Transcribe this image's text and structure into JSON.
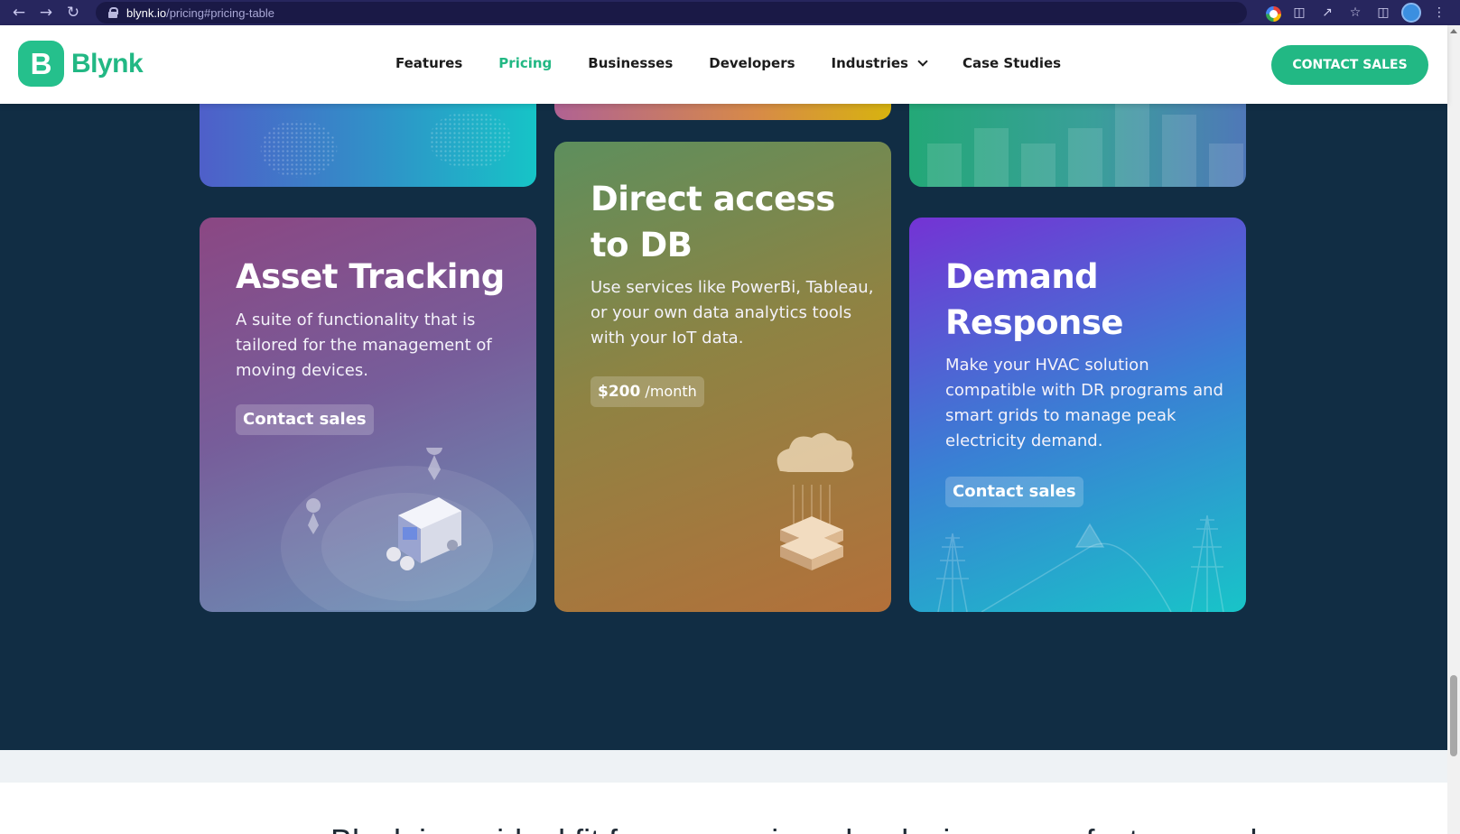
{
  "browser": {
    "url_host": "blynk.io",
    "url_path": "/pricing#pricing-table",
    "icons": [
      "back-icon",
      "forward-icon",
      "reload-icon",
      "lock-icon",
      "google-icon",
      "translate-icon",
      "share-icon",
      "star-icon",
      "sidebar-icon",
      "profile-avatar",
      "menu-icon"
    ]
  },
  "site": {
    "logo_letter": "B",
    "logo_text": "Blynk",
    "nav": [
      {
        "label": "Features"
      },
      {
        "label": "Pricing"
      },
      {
        "label": "Businesses"
      },
      {
        "label": "Developers"
      },
      {
        "label": "Industries"
      },
      {
        "label": "Case Studies"
      }
    ],
    "contact_button": "CONTACT SALES",
    "accent_color": "#22b884",
    "dark_bg": "#112d44"
  },
  "cards": {
    "asset": {
      "title_line1": "Asset Tracking",
      "desc_line1": "A suite of functionality that is",
      "desc_line2": "tailored for the management of",
      "desc_line3": "moving devices.",
      "button": "Contact sales"
    },
    "db": {
      "title_line1": "Direct access",
      "title_line2": "to DB",
      "desc_line1": "Use services like PowerBi, Tableau,",
      "desc_line2": "or your own data analytics tools",
      "desc_line3": "with your IoT data.",
      "price_amount": "$200",
      "price_period": "/month"
    },
    "demand": {
      "title_line1": "Demand",
      "title_line2": "Response",
      "desc_line1": "Make your HVAC solution",
      "desc_line2": "compatible with DR programs and",
      "desc_line3": "smart grids to manage peak",
      "desc_line4": "electricity demand.",
      "button": "Contact sales"
    }
  },
  "bottom_text": "Blynk is an ideal fit for companies who design, manufacture, and"
}
